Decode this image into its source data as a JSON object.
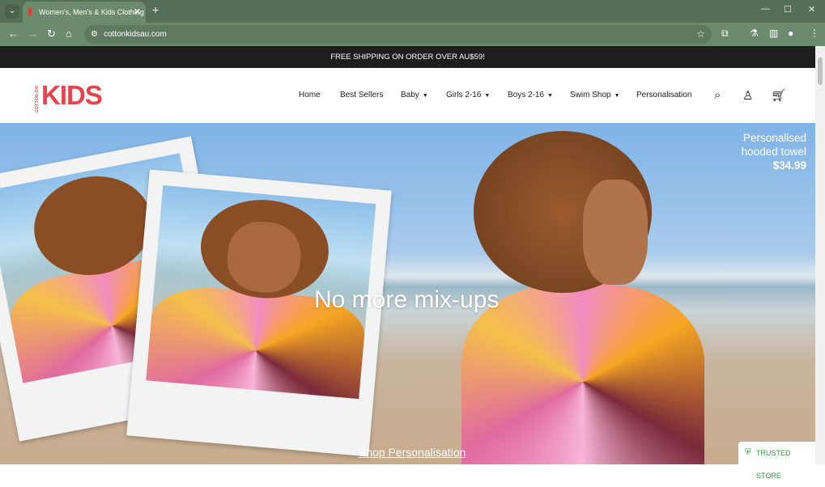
{
  "browser": {
    "tab_title": "Women's, Men's & Kids Clothing",
    "url": "cottonkidsau.com"
  },
  "promo": {
    "text": "FREE SHIPPING ON ORDER OVER AU$59!"
  },
  "logo": {
    "small": "COTTON:ON",
    "big": "KIDS",
    "color": "#e8424b"
  },
  "nav": {
    "items": [
      {
        "label": "Home"
      },
      {
        "label": "Best Sellers"
      },
      {
        "label": "Baby",
        "dropdown": true
      },
      {
        "label": "Girls 2-16",
        "dropdown": true
      },
      {
        "label": "Boys 2-16",
        "dropdown": true
      },
      {
        "label": "Swim Shop",
        "dropdown": true
      },
      {
        "label": "Personalisation"
      }
    ]
  },
  "hero": {
    "headline": "No more mix-ups",
    "cta": "Shop Personalisation",
    "product_line1": "Personalised",
    "product_line2": "hooded towel",
    "product_price": "$34.99"
  },
  "trust": {
    "label": "TRUSTED STORE",
    "color": "#2e9a3a"
  }
}
